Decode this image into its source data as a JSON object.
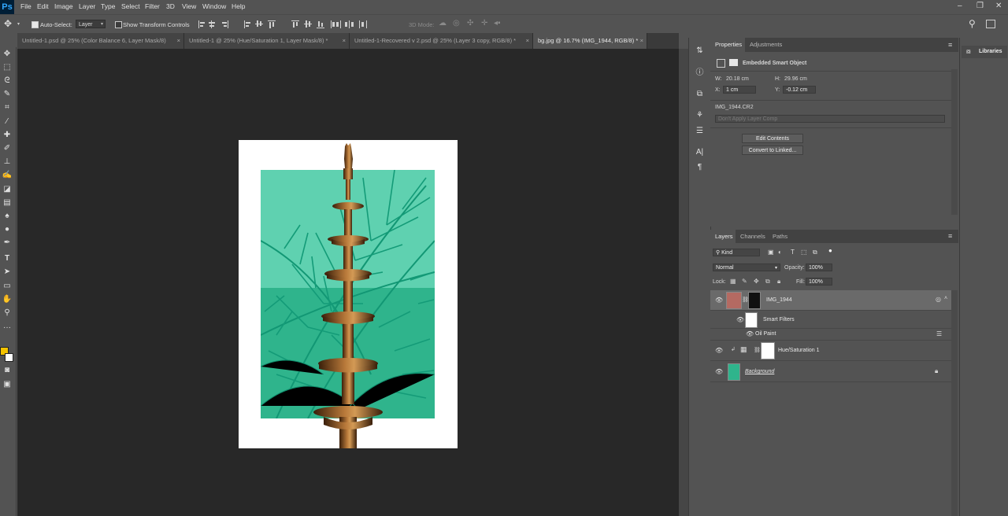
{
  "app": {
    "logo": "Ps"
  },
  "menu": [
    "File",
    "Edit",
    "Image",
    "Layer",
    "Type",
    "Select",
    "Filter",
    "3D",
    "View",
    "Window",
    "Help"
  ],
  "window_controls": [
    "–",
    "❐",
    "✕"
  ],
  "options": {
    "move_icon": "move-icon",
    "auto_select_label": "Auto-Select:",
    "auto_select_checked": true,
    "auto_select_value": "Layer",
    "transform_label": "Show Transform Controls",
    "mode_3d_label": "3D Mode:"
  },
  "tabs": [
    {
      "label": "Untitled-1.psd @ 25% (Color Balance 6, Layer Mask/8)",
      "close": "×"
    },
    {
      "label": "Untitled-1 @ 25% (Hue/Saturation 1, Layer Mask/8) *",
      "close": "×"
    },
    {
      "label": "Untitled-1-Recovered v 2.psd @ 25% (Layer 3 copy, RGB/8) *",
      "close": "×"
    },
    {
      "label": "bg.jpg @ 16.7% (IMG_1944, RGB/8) *",
      "close": "×"
    }
  ],
  "colors": {
    "foreground": "#f5c400",
    "background": "#ffffff",
    "canvas_bg": "#282828",
    "teal": "#3fbf9a",
    "leaf": "#16997a",
    "brass": "#7a4a1e"
  },
  "properties": {
    "tab_active": "Properties",
    "tab_inactive": "Adjustments",
    "object_type": "Embedded Smart Object",
    "w_label": "W:",
    "w_value": "20.18 cm",
    "h_label": "H:",
    "h_value": "29.96 cm",
    "x_label": "X:",
    "x_value": "1 cm",
    "y_label": "Y:",
    "y_value": "-0.12 cm",
    "filename": "IMG_1944.CR2",
    "layer_comp": "Don't Apply Layer Comp",
    "edit_contents": "Edit Contents",
    "convert_linked": "Convert to Linked..."
  },
  "layers_panel": {
    "tabs": [
      "Layers",
      "Channels",
      "Paths"
    ],
    "kind": "Kind",
    "blend_mode": "Normal",
    "opacity_label": "Opacity:",
    "opacity_value": "100%",
    "lock_label": "Lock:",
    "fill_label": "Fill:",
    "fill_value": "100%",
    "layers": [
      {
        "name": "IMG_1944",
        "selected": true
      },
      {
        "name": "Smart Filters"
      },
      {
        "name": "Oil Paint"
      },
      {
        "name": "Hue/Saturation 1"
      },
      {
        "name": "Background"
      }
    ]
  },
  "libraries": {
    "label": "Libraries"
  }
}
